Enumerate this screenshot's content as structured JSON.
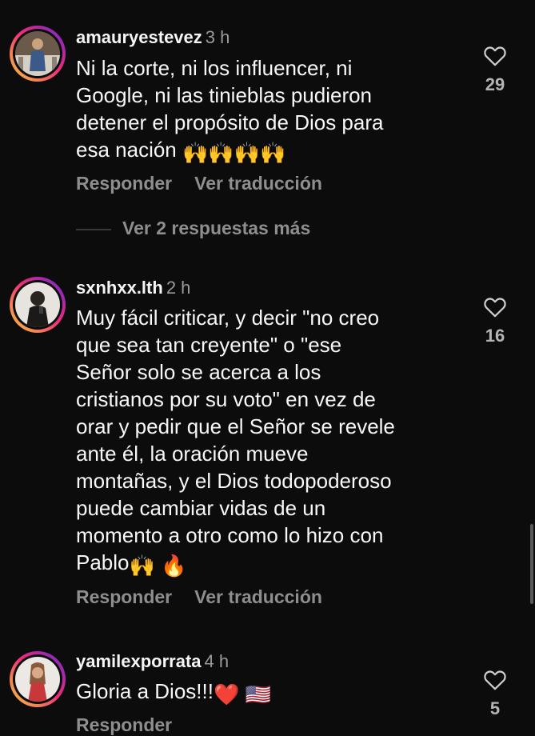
{
  "comments": [
    {
      "username": "amauryestevez",
      "time": "3 h",
      "lines": [
        "Ni la corte, ni los influencer, ni",
        "Google, ni las tinieblas pudieron",
        "detener el propósito de Dios para",
        "esa nación"
      ],
      "emoji_suffix": "🙌🙌🙌🙌",
      "likes": "29",
      "reply_label": "Responder",
      "translate_label": "Ver traducción"
    },
    {
      "username": "sxnhxx.lth",
      "time": "2 h",
      "lines": [
        "Muy fácil criticar, y decir \"no creo",
        "que sea tan creyente\" o \"ese",
        "Señor solo se acerca a los",
        "cristianos por su voto\" en vez de",
        "orar y pedir que el Señor se revele",
        "ante él, la oración mueve",
        "montañas, y el Dios todopoderoso",
        "puede cambiar vidas de un",
        "momento a otro como lo hizo con",
        "Pablo"
      ],
      "emoji_suffix": "🙌 🔥",
      "likes": "16",
      "reply_label": "Responder",
      "translate_label": "Ver traducción"
    },
    {
      "username": "yamilexporrata",
      "time": "4 h",
      "lines": [
        "Gloria a Dios!!!"
      ],
      "emoji_suffix": "❤️ 🇺🇸",
      "likes": "5",
      "reply_label": "Responder"
    }
  ],
  "more_replies_label": "Ver 2 respuestas más",
  "colors": {
    "background": "#0c0c0c",
    "text": "#f7f7f7",
    "muted": "#8e8e8e",
    "ring_gradient": [
      "#f9ce34",
      "#ee2a7b",
      "#6228d7"
    ]
  },
  "icons": {
    "like": "heart-outline-icon"
  }
}
